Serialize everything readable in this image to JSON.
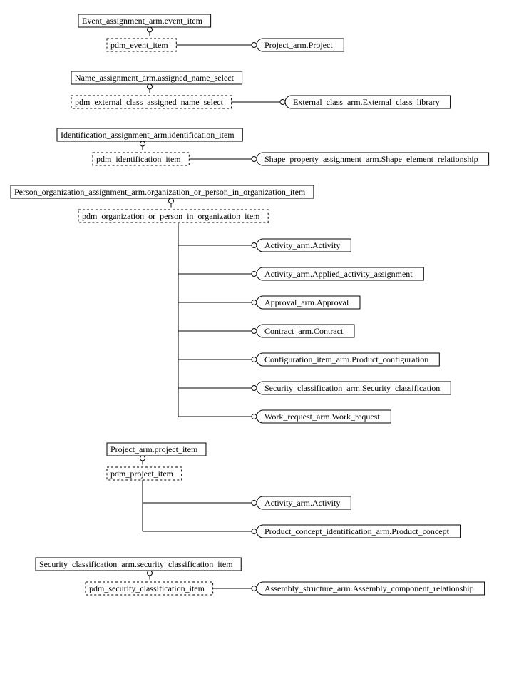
{
  "g1": {
    "parent": "Event_assignment_arm.event_item",
    "child": "pdm_event_item",
    "leaves": [
      "Project_arm.Project"
    ]
  },
  "g2": {
    "parent": "Name_assignment_arm.assigned_name_select",
    "child": "pdm_external_class_assigned_name_select",
    "leaves": [
      "External_class_arm.External_class_library"
    ]
  },
  "g3": {
    "parent": "Identification_assignment_arm.identification_item",
    "child": "pdm_identification_item",
    "leaves": [
      "Shape_property_assignment_arm.Shape_element_relationship"
    ]
  },
  "g4": {
    "parent": "Person_organization_assignment_arm.organization_or_person_in_organization_item",
    "child": "pdm_organization_or_person_in_organization_item",
    "leaves": [
      "Activity_arm.Activity",
      "Activity_arm.Applied_activity_assignment",
      "Approval_arm.Approval",
      "Contract_arm.Contract",
      "Configuration_item_arm.Product_configuration",
      "Security_classification_arm.Security_classification",
      "Work_request_arm.Work_request"
    ]
  },
  "g5": {
    "parent": "Project_arm.project_item",
    "child": "pdm_project_item",
    "leaves": [
      "Activity_arm.Activity",
      "Product_concept_identification_arm.Product_concept"
    ]
  },
  "g6": {
    "parent": "Security_classification_arm.security_classification_item",
    "child": "pdm_security_classification_item",
    "leaves": [
      "Assembly_structure_arm.Assembly_component_relationship"
    ]
  }
}
